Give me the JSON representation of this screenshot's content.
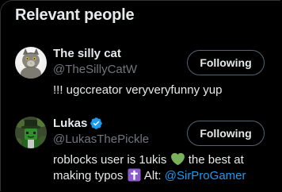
{
  "panel": {
    "title": "Relevant people"
  },
  "people": [
    {
      "display_name": "The silly cat",
      "handle": "@TheSillyCatW",
      "verified": false,
      "follow_label": "Following",
      "bio": "!!! ugccreator veryveryfunny yup",
      "avatar_icon": "cat-avatar"
    },
    {
      "display_name": "Lukas",
      "handle": "@LukasThePickle",
      "verified": true,
      "follow_label": "Following",
      "bio_part1": "roblocks user is 1ukis",
      "bio_part2": "the best at making typos",
      "bio_part3": "Alt:",
      "bio_link": "@SirProGamer",
      "avatar_icon": "pickle-avatar"
    }
  ],
  "colors": {
    "background": "#000000",
    "primary_text": "#e7e9ea",
    "secondary_text": "#71767b",
    "link": "#1d9bf0",
    "verified_badge": "#1d9bf0",
    "button_border": "#536471"
  },
  "icons": {
    "verified": "verified-badge-icon",
    "heart": "green-heart-icon",
    "cross": "latin-cross-icon"
  }
}
